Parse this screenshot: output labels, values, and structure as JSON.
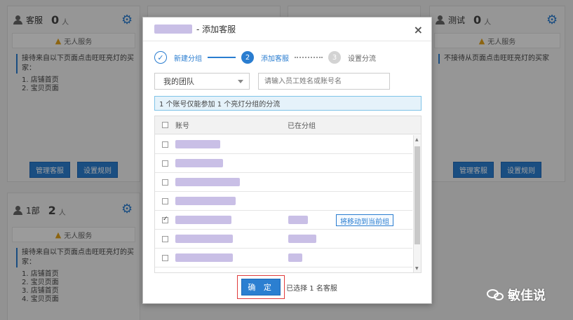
{
  "background_cards": [
    {
      "name": "客服",
      "count": "0",
      "unit": "人",
      "warning": "无人服务",
      "desc": "接待来自以下页面点击旺旺亮灯的买家：",
      "pages": [
        "1. 店铺首页",
        "2. 宝贝页面"
      ],
      "btn_manage": "管理客服",
      "btn_rules": "设置规则"
    },
    {
      "name": "测试",
      "count": "0",
      "unit": "人",
      "warning": "无人服务",
      "desc": "不接待从页面点击旺旺亮灯的买家",
      "pages": [],
      "btn_manage": "管理客服",
      "btn_rules": "设置规则"
    },
    {
      "name": "1部",
      "count": "2",
      "unit": "人",
      "warning": "无人服务",
      "desc": "接待来自以下页面点击旺旺亮灯的买家：",
      "pages": [
        "1. 店铺首页",
        "2. 宝贝页面",
        "3. 店铺首页",
        "4. 宝贝页面"
      ]
    }
  ],
  "modal": {
    "title_suffix": "- 添加客服",
    "close": "×",
    "steps": [
      {
        "label": "新建分组",
        "mark": "✓"
      },
      {
        "label": "添加客服",
        "mark": "2"
      },
      {
        "label": "设置分流",
        "mark": "3"
      }
    ],
    "team_select": "我的团队",
    "search_placeholder": "请输入员工姓名或账号名",
    "tip": "1 个账号仅能参加 1 个亮灯分组的分流",
    "table": {
      "col_account": "账号",
      "col_group": "已在分组",
      "move_label": "将移动到当前组"
    },
    "confirm": "确 定",
    "selected_info": "已选择 1 名客服"
  },
  "watermark": {
    "text": "敏佳说"
  },
  "colors": {
    "accent": "#2a7dd0",
    "highlight_border": "#e03c3c",
    "blur": "#c9bfe6"
  }
}
